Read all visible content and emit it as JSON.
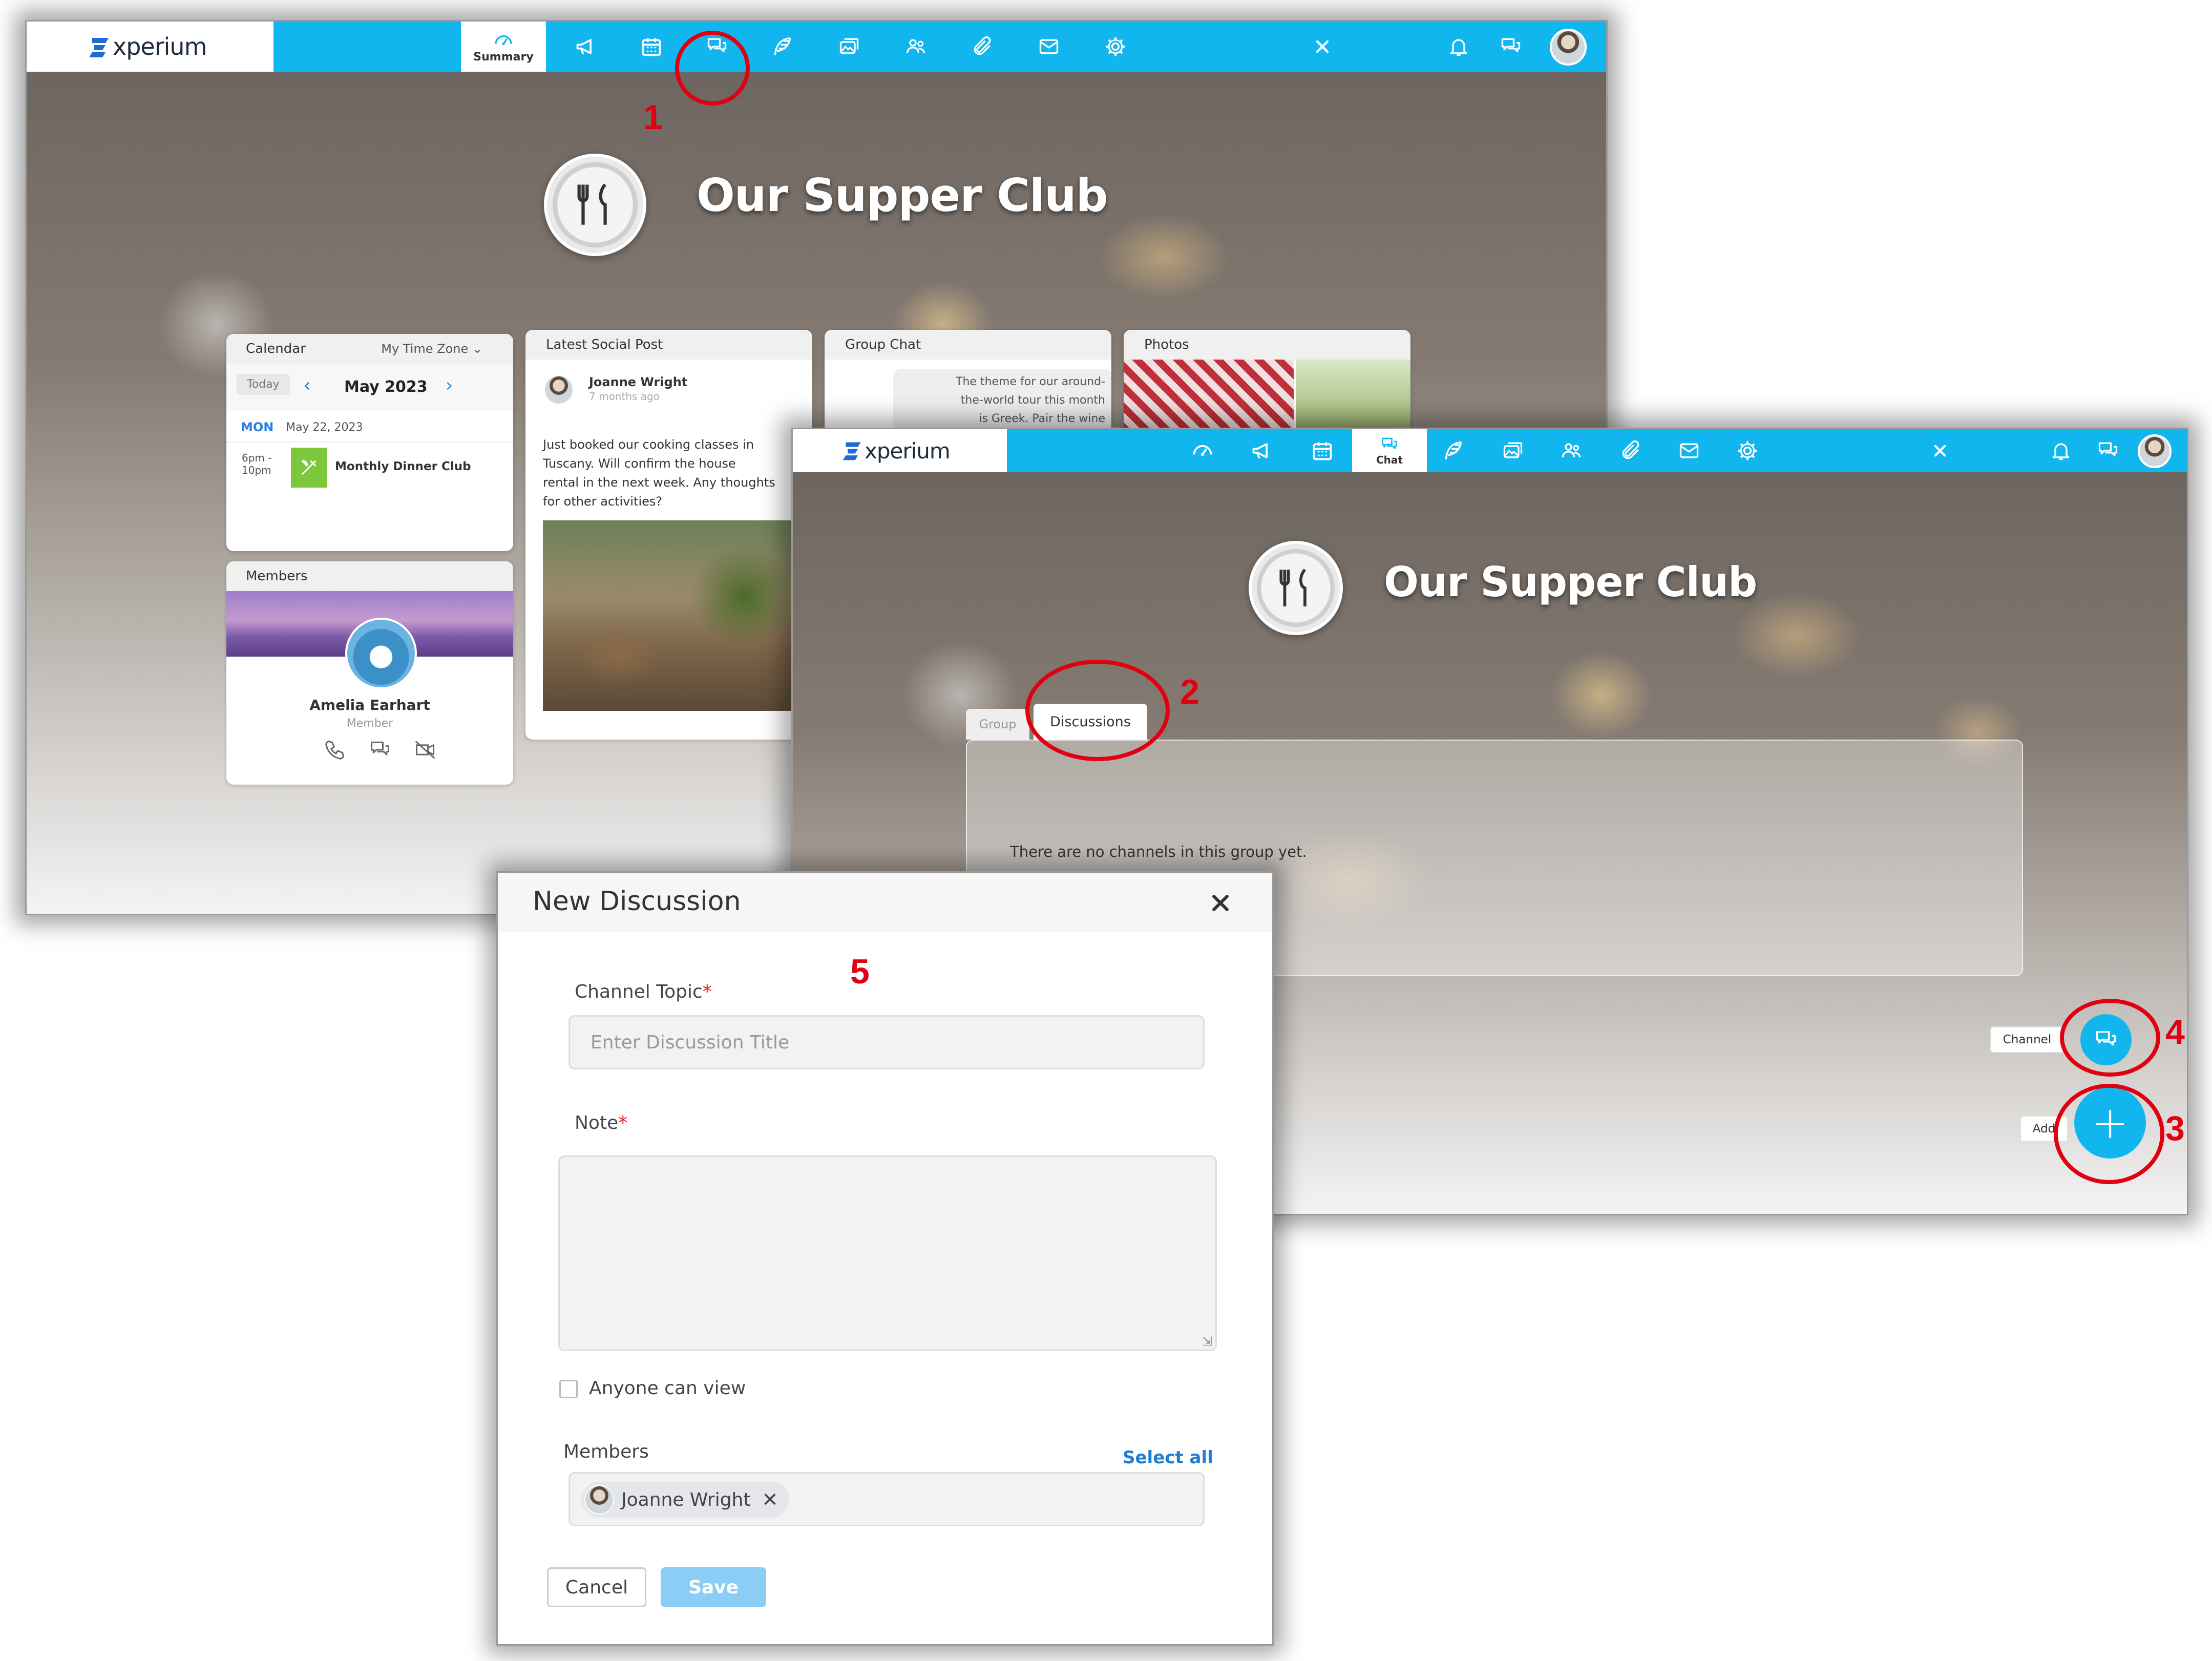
{
  "brand": {
    "logo_text": "xperium"
  },
  "colors": {
    "navbar": "#12b6ee",
    "accent_red": "#e00010",
    "link_blue": "#1a7fd4",
    "save_disabled": "#8ccdf5",
    "fab_blue": "#12b6ee"
  },
  "window1": {
    "active_tab_label": "Summary",
    "group_title": "Our Supper Club",
    "calendar": {
      "title": "Calendar",
      "timezone": "My Time Zone",
      "today_button": "Today",
      "month": "May 2023",
      "day_abbr": "MON",
      "date": "May 22, 2023",
      "time_start": "6pm -",
      "time_end": "10pm",
      "event": "Monthly Dinner Club"
    },
    "members": {
      "title": "Members",
      "name": "Amelia Earhart",
      "role": "Member"
    },
    "social": {
      "title": "Latest Social Post",
      "author": "Joanne Wright",
      "time": "7 months ago",
      "text_lines": [
        "Just booked our cooking classes in",
        "Tuscany. Will confirm the house",
        "rental in the next week. Any thoughts",
        "for other activities?"
      ]
    },
    "group_chat": {
      "title": "Group Chat",
      "message_lines": [
        "The theme for our around-",
        "the-world tour this month",
        "is Greek. Pair the wine"
      ]
    },
    "photos": {
      "title": "Photos"
    }
  },
  "window2": {
    "active_tab_label": "Chat",
    "group_title": "Our Supper Club",
    "tabs": [
      {
        "label": "Group"
      },
      {
        "label": "Discussions"
      }
    ],
    "empty_message": "There are no channels in this group yet.",
    "fab_channel_label": "Channel",
    "fab_add_label": "Add"
  },
  "dialog": {
    "title": "New Discussion",
    "topic_label": "Channel Topic",
    "topic_placeholder": "Enter Discussion Title",
    "note_label": "Note",
    "required_mark": "*",
    "anyone_can_view": "Anyone can view",
    "members_label": "Members",
    "select_all": "Select all",
    "member_chip": "Joanne Wright",
    "cancel": "Cancel",
    "save": "Save"
  },
  "annotations": [
    "1",
    "2",
    "3",
    "4",
    "5"
  ],
  "icons": [
    "dashboard-icon",
    "megaphone-icon",
    "calendar-icon",
    "chat-icon",
    "feather-icon",
    "photos-icon",
    "people-icon",
    "paperclip-icon",
    "mail-icon",
    "gear-icon",
    "close-icon",
    "bell-icon",
    "chat-icon",
    "avatar"
  ]
}
